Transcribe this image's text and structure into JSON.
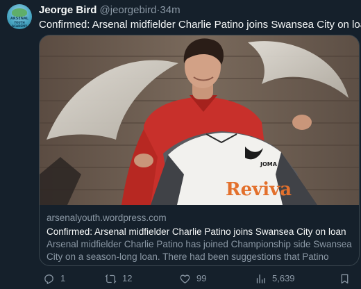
{
  "tweet": {
    "author_name": "Jeorge Bird",
    "handle": "@jeorgebird",
    "separator": "·",
    "time": "34m",
    "text": "Confirmed: Arsenal midfielder Charlie Patino joins Swansea City on loan",
    "avatar": {
      "line1": "ARSENAL",
      "line2": "YOUTH ACADEMY"
    }
  },
  "card": {
    "image_overlay": {
      "sponsor": "Reviva",
      "kit_maker": "JOMA"
    },
    "domain": "arsenalyouth.wordpress.com",
    "title": "Confirmed: Arsenal midfielder Charlie Patino joins Swansea City on loan",
    "description": "Arsenal midfielder Charlie Patino has joined Championship side Swansea City on a season-long loan. There had been suggestions that Patino could depar..."
  },
  "actions": {
    "replies": "1",
    "retweets": "12",
    "likes": "99",
    "views": "5,639"
  },
  "icons": {
    "reply": "reply-icon",
    "retweet": "retweet-icon",
    "like": "heart-icon",
    "views": "bar-chart-icon",
    "bookmark": "bookmark-icon"
  },
  "colors": {
    "background": "#15202b",
    "text": "#f7f9f9",
    "muted": "#8b98a5",
    "border": "#38444d"
  }
}
